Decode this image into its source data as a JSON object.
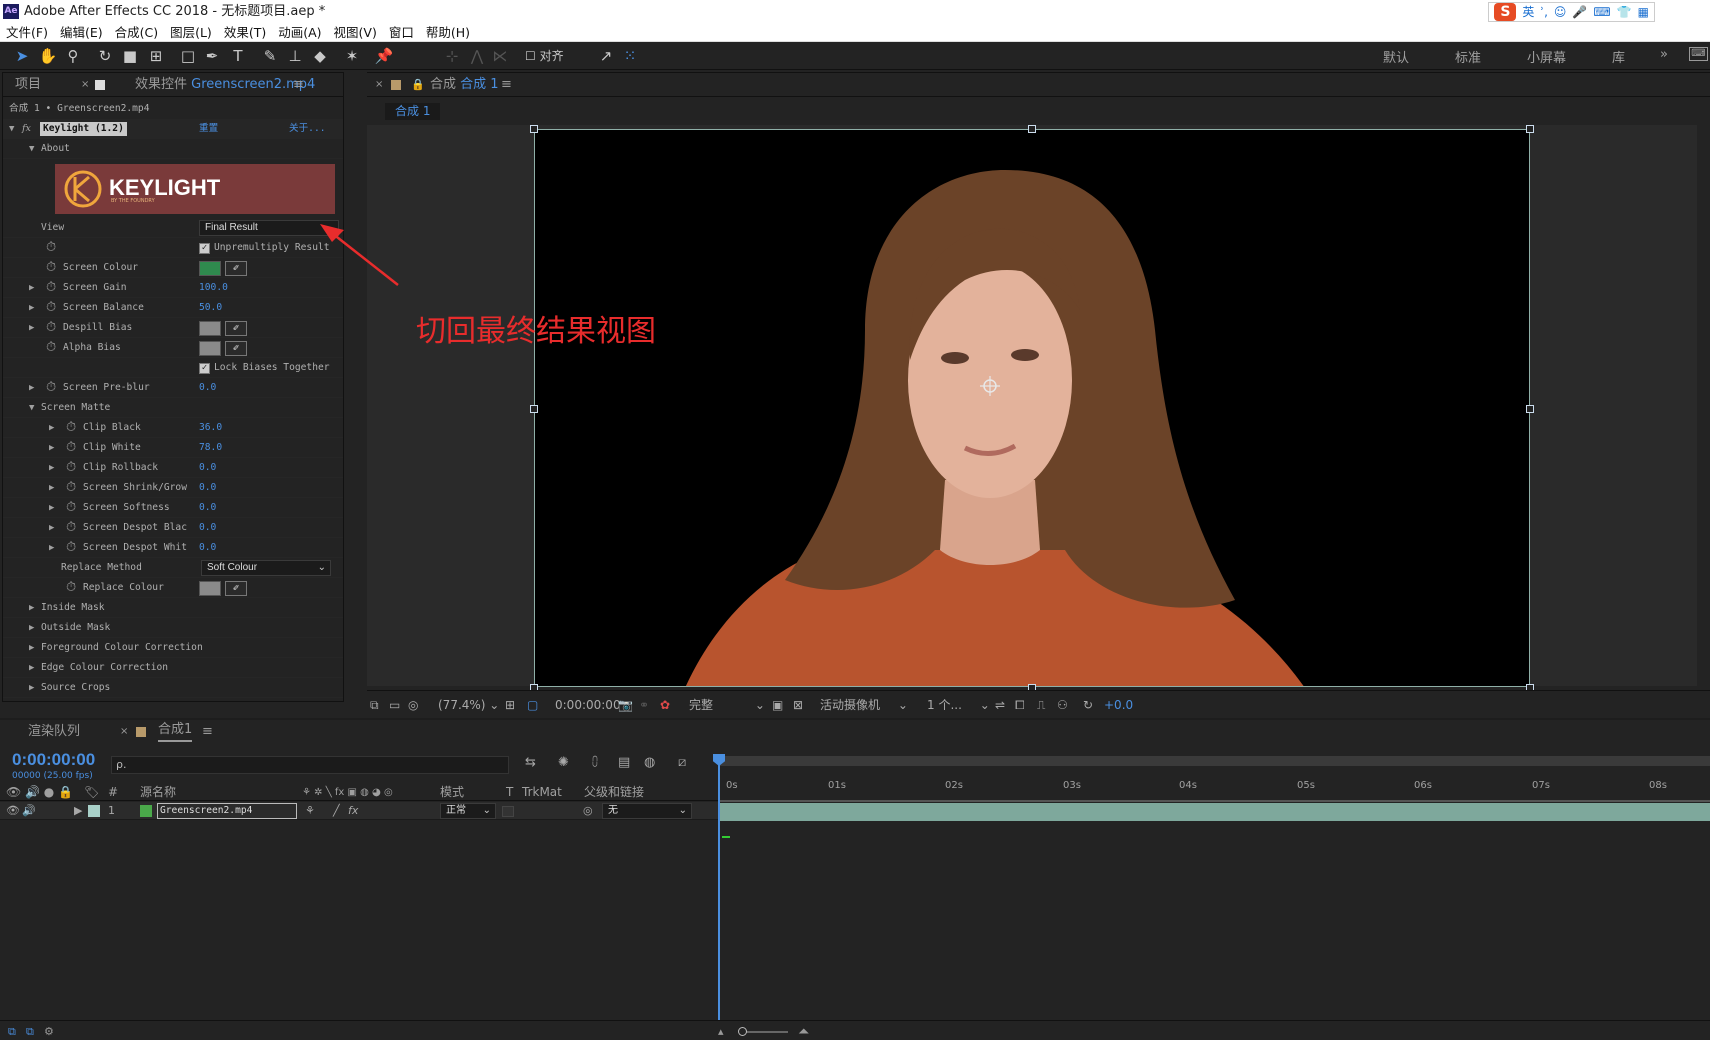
{
  "titlebar": {
    "app_icon": "Ae",
    "title": "Adobe After Effects CC 2018 - 无标题项目.aep *",
    "ime": {
      "logo": "S",
      "mode": "英",
      "items": [
        "ʾ,",
        "☺",
        "🎤",
        "⌨",
        "👕",
        "▦"
      ]
    }
  },
  "menu": [
    "文件(F)",
    "编辑(E)",
    "合成(C)",
    "图层(L)",
    "效果(T)",
    "动画(A)",
    "视图(V)",
    "窗口",
    "帮助(H)"
  ],
  "toolbar": {
    "align_label": "对齐",
    "workspaces": [
      "默认",
      "标准",
      "小屏幕",
      "库"
    ],
    "more": "»"
  },
  "project_panel": {
    "tab": "项目"
  },
  "effect_controls": {
    "tab_prefix": "效果控件",
    "tab_layer": "Greenscreen2.mp4",
    "breadcrumb": "合成 1 • Greenscreen2.mp4",
    "effect_name": "Keylight (1.2)",
    "reset": "重置",
    "about": "关于...",
    "about_group": "About",
    "logo_text": "KEYLIGHT",
    "logo_sub": "BY THE FOUNDRY",
    "view_label": "View",
    "view_value": "Final Result",
    "unpremultiply": "Unpremultiply Result",
    "screen_colour": "Screen Colour",
    "screen_colour_hex": "#2f8a4e",
    "screen_gain_label": "Screen Gain",
    "screen_gain": "100.0",
    "screen_balance_label": "Screen Balance",
    "screen_balance": "50.0",
    "despill_bias": "Despill Bias",
    "alpha_bias": "Alpha Bias",
    "lock_biases": "Lock Biases Together",
    "screen_preblur_label": "Screen Pre-blur",
    "screen_preblur": "0.0",
    "screen_matte": "Screen Matte",
    "clip_black_label": "Clip Black",
    "clip_black": "36.0",
    "clip_white_label": "Clip White",
    "clip_white": "78.0",
    "clip_rollback_label": "Clip Rollback",
    "clip_rollback": "0.0",
    "shrink_grow_label": "Screen Shrink/Grow",
    "shrink_grow": "0.0",
    "softness_label": "Screen Softness",
    "softness": "0.0",
    "despot_black_label": "Screen Despot Blac",
    "despot_black": "0.0",
    "despot_white_label": "Screen Despot Whit",
    "despot_white": "0.0",
    "replace_method_label": "Replace Method",
    "replace_method": "Soft Colour",
    "replace_colour": "Replace Colour",
    "inside_mask": "Inside Mask",
    "outside_mask": "Outside Mask",
    "fg_colour_correction": "Foreground Colour Correction",
    "edge_colour_correction": "Edge Colour Correction",
    "source_crops": "Source Crops"
  },
  "comp_panel": {
    "tab_prefix": "合成",
    "tab_name": "合成 1",
    "sub_tab": "合成 1"
  },
  "annotation": {
    "text": "切回最终结果视图",
    "color": "#e82c2c"
  },
  "viewer_bar": {
    "zoom": "(77.4%)",
    "time": "0:00:00:00",
    "resolution": "完整",
    "camera": "活动摄像机",
    "views": "1 个...",
    "exposure": "+0.0"
  },
  "timeline": {
    "render_queue_tab": "渲染队列",
    "comp_tab": "合成1",
    "timecode": "0:00:00:00",
    "fps": "00000 (25.00 fps)",
    "search_placeholder": "ρ.",
    "col_num": "#",
    "col_source": "源名称",
    "col_mode": "模式",
    "col_t": "T",
    "col_trkmat": "TrkMat",
    "col_parent": "父级和链接",
    "layer_num": "1",
    "layer_name": "Greenscreen2.mp4",
    "layer_mode": "正常",
    "layer_parent": "无",
    "ticks": [
      "0s",
      "01s",
      "02s",
      "03s",
      "04s",
      "05s",
      "06s",
      "07s",
      "08s"
    ]
  }
}
